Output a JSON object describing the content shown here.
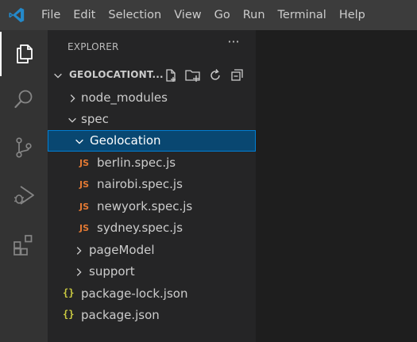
{
  "menu": [
    "File",
    "Edit",
    "Selection",
    "View",
    "Go",
    "Run",
    "Terminal",
    "Help"
  ],
  "activity": [
    {
      "name": "explorer",
      "active": true
    },
    {
      "name": "search",
      "active": false
    },
    {
      "name": "source-control",
      "active": false
    },
    {
      "name": "run-debug",
      "active": false
    },
    {
      "name": "extensions",
      "active": false
    }
  ],
  "sidebar": {
    "title": "EXPLORER",
    "more": "···",
    "root": "GEOLOCATIONT...",
    "tree": [
      {
        "label": "node_modules",
        "type": "folder",
        "expanded": false
      },
      {
        "label": "spec",
        "type": "folder",
        "expanded": true
      },
      {
        "label": "Geolocation",
        "type": "folder",
        "expanded": true,
        "selected": true
      },
      {
        "label": "berlin.spec.js",
        "type": "js",
        "badge": "JS"
      },
      {
        "label": "nairobi.spec.js",
        "type": "js",
        "badge": "JS"
      },
      {
        "label": "newyork.spec.js",
        "type": "js",
        "badge": "JS"
      },
      {
        "label": "sydney.spec.js",
        "type": "js",
        "badge": "JS"
      },
      {
        "label": "pageModel",
        "type": "folder",
        "expanded": false
      },
      {
        "label": "support",
        "type": "folder",
        "expanded": false
      },
      {
        "label": "package-lock.json",
        "type": "json",
        "badge": "{}"
      },
      {
        "label": "package.json",
        "type": "json",
        "badge": "{}"
      }
    ]
  },
  "colors": {
    "accent": "#007acc",
    "selection": "#094771",
    "js_icon": "#e37933",
    "json_icon": "#cbcb41"
  }
}
